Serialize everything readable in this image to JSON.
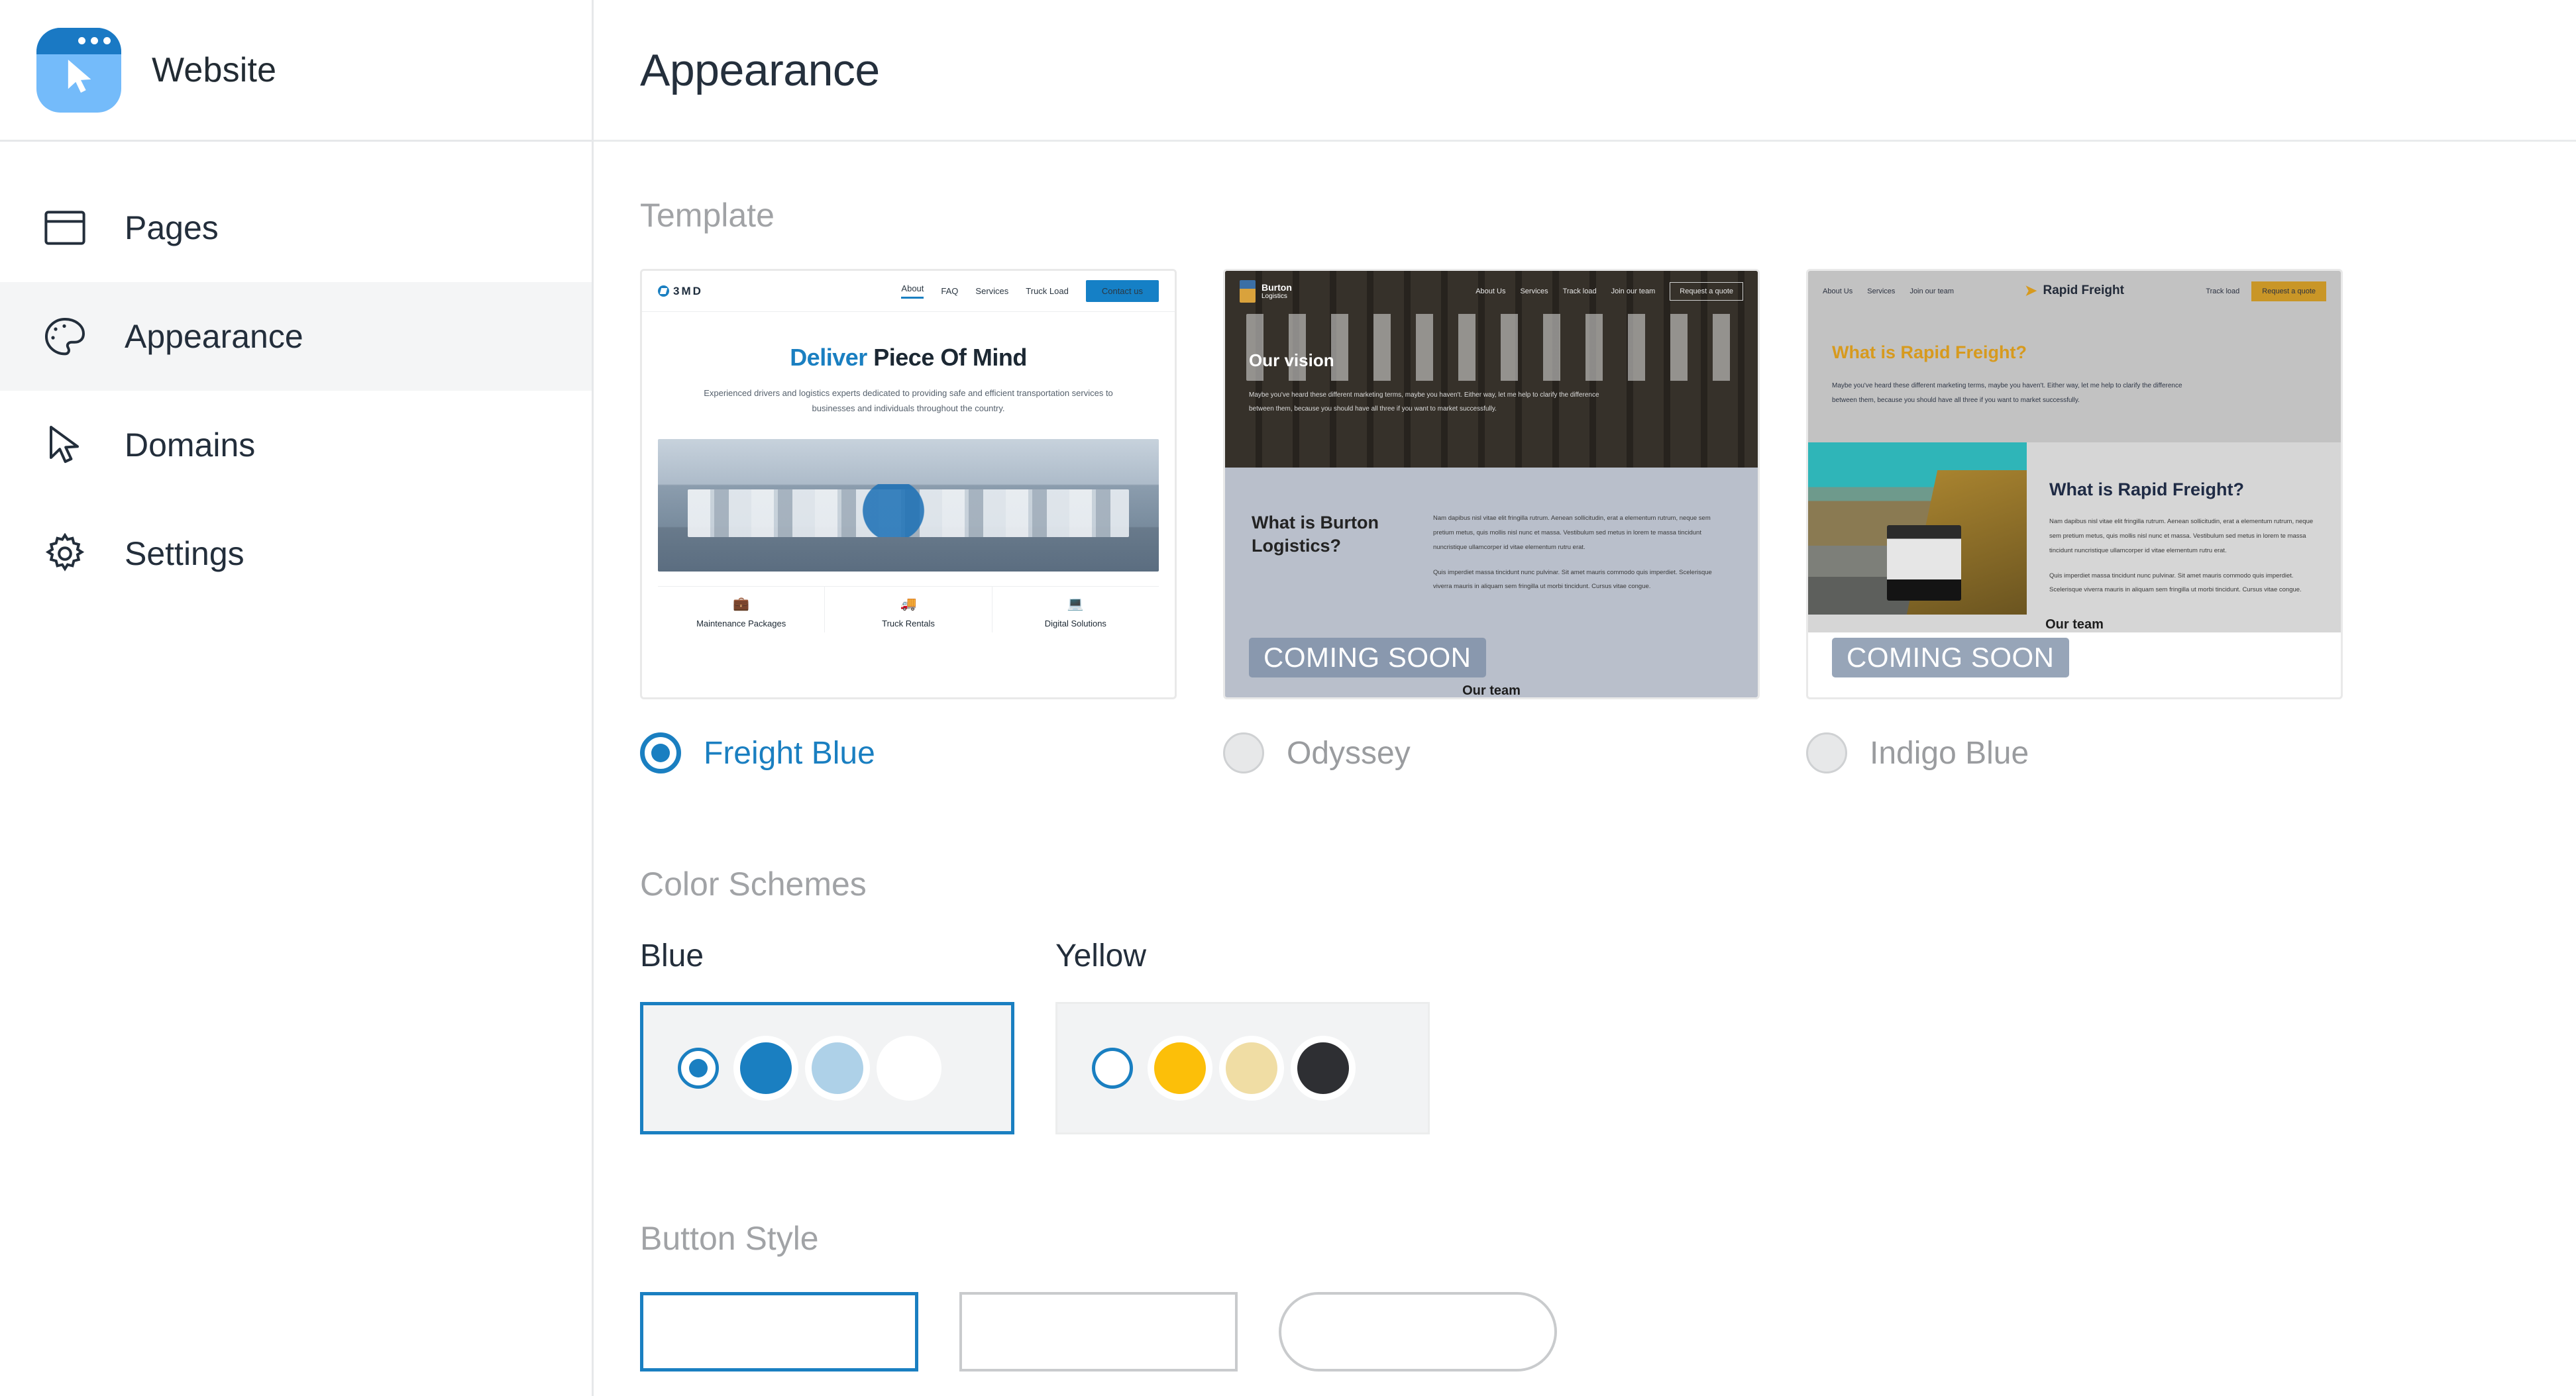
{
  "app": {
    "name": "Website",
    "icon": "browser-cursor-icon"
  },
  "sidebar": {
    "items": [
      {
        "label": "Pages",
        "icon": "browser-window-icon",
        "active": false
      },
      {
        "label": "Appearance",
        "icon": "palette-icon",
        "active": true
      },
      {
        "label": "Domains",
        "icon": "cursor-arrow-icon",
        "active": false
      },
      {
        "label": "Settings",
        "icon": "gear-icon",
        "active": false
      }
    ]
  },
  "header": {
    "title": "Appearance"
  },
  "sections": {
    "template_label": "Template",
    "color_schemes_label": "Color Schemes",
    "button_style_label": "Button Style"
  },
  "templates": [
    {
      "name": "Freight Blue",
      "selected": true,
      "coming_soon": false,
      "preview": {
        "logo": "3MD",
        "nav": [
          "About",
          "FAQ",
          "Services",
          "Truck Load"
        ],
        "cta": "Contact us",
        "headline_accent": "Deliver",
        "headline_rest": " Piece Of Mind",
        "subhead": "Experienced drivers and logistics experts dedicated to providing safe and efficient transportation services to businesses and individuals throughout the country.",
        "cards": [
          {
            "title": "Maintenance Packages",
            "icon": "briefcase-icon"
          },
          {
            "title": "Truck Rentals",
            "icon": "hand-truck-icon"
          },
          {
            "title": "Digital Solutions",
            "icon": "laptop-icon"
          }
        ]
      }
    },
    {
      "name": "Odyssey",
      "selected": false,
      "coming_soon": true,
      "coming_soon_label": "COMING SOON",
      "preview": {
        "logo_line1": "Burton",
        "logo_line2": "Logistics",
        "nav": [
          "About Us",
          "Services",
          "Track load",
          "Join our team"
        ],
        "cta": "Request a quote",
        "hero_title": "Our vision",
        "hero_text": "Maybe you've heard these different marketing terms, maybe you haven't. Either way, let me help to clarify the difference between them, because you should have all three if you want to market successfully.",
        "section_title": "What is Burton Logistics?",
        "body_p1": "Nam dapibus nisl vitae elit fringilla rutrum. Aenean sollicitudin, erat a elementum rutrum, neque sem pretium metus, quis mollis nisl nunc et massa. Vestibulum sed metus in lorem te massa tincidunt nuncristique ullamcorper id vitae elementum rutru erat.",
        "body_p2": "Quis imperdiet massa tincidunt nunc pulvinar. Sit amet mauris commodo quis imperdiet. Scelerisque viverra mauris in aliquam sem fringilla ut morbi tincidunt. Cursus vitae congue.",
        "footer_title": "Our team"
      }
    },
    {
      "name": "Indigo Blue",
      "selected": false,
      "coming_soon": true,
      "coming_soon_label": "COMING SOON",
      "preview": {
        "logo": "Rapid Freight",
        "nav_left": [
          "About Us",
          "Services",
          "Join our team"
        ],
        "nav_right": [
          "Track load"
        ],
        "cta": "Request a quote",
        "hero_title": "What is Rapid Freight?",
        "hero_text": "Maybe you've heard these different marketing terms, maybe you haven't. Either way, let me help to clarify the difference between them, because you should have all three if you want to market successfully.",
        "section_title": "What is Rapid Freight?",
        "body_p1": "Nam dapibus nisl vitae elit fringilla rutrum. Aenean sollicitudin, erat a elementum rutrum, neque sem pretium metus, quis mollis nisl nunc et massa. Vestibulum sed metus in lorem te massa tincidunt nuncristique ullamcorper id vitae elementum rutru erat.",
        "body_p2": "Quis imperdiet massa tincidunt nunc pulvinar. Sit amet mauris commodo quis imperdiet. Scelerisque viverra mauris in aliquam sem fringilla ut morbi tincidunt. Cursus vitae congue.",
        "footer_title": "Our team"
      }
    }
  ],
  "color_schemes": [
    {
      "name": "Blue",
      "selected": true,
      "swatches": [
        "#1a7fc1",
        "#aed1e8",
        "#ffffff"
      ]
    },
    {
      "name": "Yellow",
      "selected": false,
      "swatches": [
        "#fcbf09",
        "#f0dda4",
        "#2e2f33"
      ]
    }
  ],
  "button_styles": [
    {
      "shape": "square",
      "selected": true
    },
    {
      "shape": "square",
      "selected": false
    },
    {
      "shape": "rounded",
      "selected": false
    }
  ],
  "colors": {
    "accent": "#1a7fc1",
    "text": "#232e3b",
    "muted": "#a1a3a6",
    "sidebar_active_bg": "#f4f5f6",
    "border": "#e6e8ea"
  }
}
